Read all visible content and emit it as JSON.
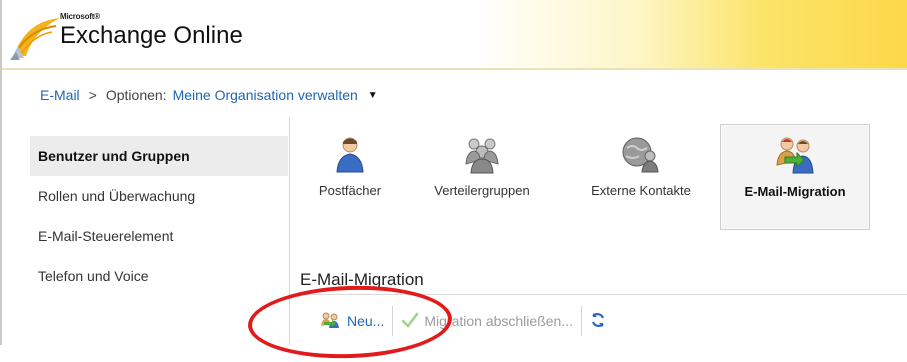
{
  "header": {
    "brand_small": "Microsoft®",
    "product_name": "Exchange Online",
    "logo_icon": "exchange-logo-icon",
    "colors": {
      "accent_gradient": "#fcd84a"
    }
  },
  "breadcrumb": {
    "root": "E-Mail",
    "separator": ">",
    "label": "Optionen:",
    "current": "Meine Organisation verwalten",
    "caret_icon": "caret-down-icon"
  },
  "sidebar": {
    "items": [
      {
        "label": "Benutzer und Gruppen",
        "active": true
      },
      {
        "label": "Rollen und Überwachung",
        "active": false
      },
      {
        "label": "E-Mail-Steuerelement",
        "active": false
      },
      {
        "label": "Telefon und Voice",
        "active": false
      }
    ]
  },
  "ribbon": {
    "items": [
      {
        "label": "Postfächer",
        "icon": "mailbox-user-icon"
      },
      {
        "label": "Verteilergruppen",
        "icon": "distribution-group-icon"
      },
      {
        "label": "Externe Kontakte",
        "icon": "external-contact-icon"
      },
      {
        "label": "E-Mail-Migration",
        "icon": "mail-migration-icon",
        "selected": true
      }
    ]
  },
  "section": {
    "title": "E-Mail-Migration"
  },
  "toolbar": {
    "new_label": "Neu...",
    "new_icon": "new-migration-icon",
    "finish_label": "Migration abschließen...",
    "finish_icon": "checkmark-icon",
    "refresh_icon": "refresh-icon"
  },
  "annotation": {
    "color": "#e21a1a"
  }
}
